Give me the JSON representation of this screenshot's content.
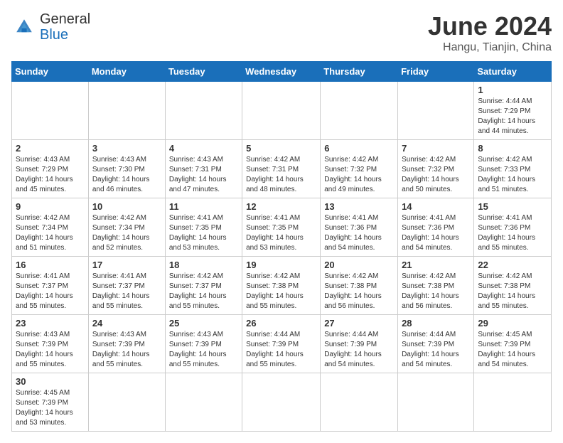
{
  "header": {
    "logo_line1": "General",
    "logo_line2": "Blue",
    "month_year": "June 2024",
    "location": "Hangu, Tianjin, China"
  },
  "weekdays": [
    "Sunday",
    "Monday",
    "Tuesday",
    "Wednesday",
    "Thursday",
    "Friday",
    "Saturday"
  ],
  "weeks": [
    [
      {
        "day": "",
        "info": ""
      },
      {
        "day": "",
        "info": ""
      },
      {
        "day": "",
        "info": ""
      },
      {
        "day": "",
        "info": ""
      },
      {
        "day": "",
        "info": ""
      },
      {
        "day": "",
        "info": ""
      },
      {
        "day": "1",
        "info": "Sunrise: 4:44 AM\nSunset: 7:29 PM\nDaylight: 14 hours\nand 44 minutes."
      }
    ],
    [
      {
        "day": "2",
        "info": "Sunrise: 4:43 AM\nSunset: 7:29 PM\nDaylight: 14 hours\nand 45 minutes."
      },
      {
        "day": "3",
        "info": "Sunrise: 4:43 AM\nSunset: 7:30 PM\nDaylight: 14 hours\nand 46 minutes."
      },
      {
        "day": "4",
        "info": "Sunrise: 4:43 AM\nSunset: 7:31 PM\nDaylight: 14 hours\nand 47 minutes."
      },
      {
        "day": "5",
        "info": "Sunrise: 4:42 AM\nSunset: 7:31 PM\nDaylight: 14 hours\nand 48 minutes."
      },
      {
        "day": "6",
        "info": "Sunrise: 4:42 AM\nSunset: 7:32 PM\nDaylight: 14 hours\nand 49 minutes."
      },
      {
        "day": "7",
        "info": "Sunrise: 4:42 AM\nSunset: 7:32 PM\nDaylight: 14 hours\nand 50 minutes."
      },
      {
        "day": "8",
        "info": "Sunrise: 4:42 AM\nSunset: 7:33 PM\nDaylight: 14 hours\nand 51 minutes."
      }
    ],
    [
      {
        "day": "9",
        "info": "Sunrise: 4:42 AM\nSunset: 7:34 PM\nDaylight: 14 hours\nand 51 minutes."
      },
      {
        "day": "10",
        "info": "Sunrise: 4:42 AM\nSunset: 7:34 PM\nDaylight: 14 hours\nand 52 minutes."
      },
      {
        "day": "11",
        "info": "Sunrise: 4:41 AM\nSunset: 7:35 PM\nDaylight: 14 hours\nand 53 minutes."
      },
      {
        "day": "12",
        "info": "Sunrise: 4:41 AM\nSunset: 7:35 PM\nDaylight: 14 hours\nand 53 minutes."
      },
      {
        "day": "13",
        "info": "Sunrise: 4:41 AM\nSunset: 7:36 PM\nDaylight: 14 hours\nand 54 minutes."
      },
      {
        "day": "14",
        "info": "Sunrise: 4:41 AM\nSunset: 7:36 PM\nDaylight: 14 hours\nand 54 minutes."
      },
      {
        "day": "15",
        "info": "Sunrise: 4:41 AM\nSunset: 7:36 PM\nDaylight: 14 hours\nand 55 minutes."
      }
    ],
    [
      {
        "day": "16",
        "info": "Sunrise: 4:41 AM\nSunset: 7:37 PM\nDaylight: 14 hours\nand 55 minutes."
      },
      {
        "day": "17",
        "info": "Sunrise: 4:41 AM\nSunset: 7:37 PM\nDaylight: 14 hours\nand 55 minutes."
      },
      {
        "day": "18",
        "info": "Sunrise: 4:42 AM\nSunset: 7:37 PM\nDaylight: 14 hours\nand 55 minutes."
      },
      {
        "day": "19",
        "info": "Sunrise: 4:42 AM\nSunset: 7:38 PM\nDaylight: 14 hours\nand 55 minutes."
      },
      {
        "day": "20",
        "info": "Sunrise: 4:42 AM\nSunset: 7:38 PM\nDaylight: 14 hours\nand 56 minutes."
      },
      {
        "day": "21",
        "info": "Sunrise: 4:42 AM\nSunset: 7:38 PM\nDaylight: 14 hours\nand 56 minutes."
      },
      {
        "day": "22",
        "info": "Sunrise: 4:42 AM\nSunset: 7:38 PM\nDaylight: 14 hours\nand 55 minutes."
      }
    ],
    [
      {
        "day": "23",
        "info": "Sunrise: 4:43 AM\nSunset: 7:39 PM\nDaylight: 14 hours\nand 55 minutes."
      },
      {
        "day": "24",
        "info": "Sunrise: 4:43 AM\nSunset: 7:39 PM\nDaylight: 14 hours\nand 55 minutes."
      },
      {
        "day": "25",
        "info": "Sunrise: 4:43 AM\nSunset: 7:39 PM\nDaylight: 14 hours\nand 55 minutes."
      },
      {
        "day": "26",
        "info": "Sunrise: 4:44 AM\nSunset: 7:39 PM\nDaylight: 14 hours\nand 55 minutes."
      },
      {
        "day": "27",
        "info": "Sunrise: 4:44 AM\nSunset: 7:39 PM\nDaylight: 14 hours\nand 54 minutes."
      },
      {
        "day": "28",
        "info": "Sunrise: 4:44 AM\nSunset: 7:39 PM\nDaylight: 14 hours\nand 54 minutes."
      },
      {
        "day": "29",
        "info": "Sunrise: 4:45 AM\nSunset: 7:39 PM\nDaylight: 14 hours\nand 54 minutes."
      }
    ],
    [
      {
        "day": "30",
        "info": "Sunrise: 4:45 AM\nSunset: 7:39 PM\nDaylight: 14 hours\nand 53 minutes."
      },
      {
        "day": "",
        "info": ""
      },
      {
        "day": "",
        "info": ""
      },
      {
        "day": "",
        "info": ""
      },
      {
        "day": "",
        "info": ""
      },
      {
        "day": "",
        "info": ""
      },
      {
        "day": "",
        "info": ""
      }
    ]
  ]
}
